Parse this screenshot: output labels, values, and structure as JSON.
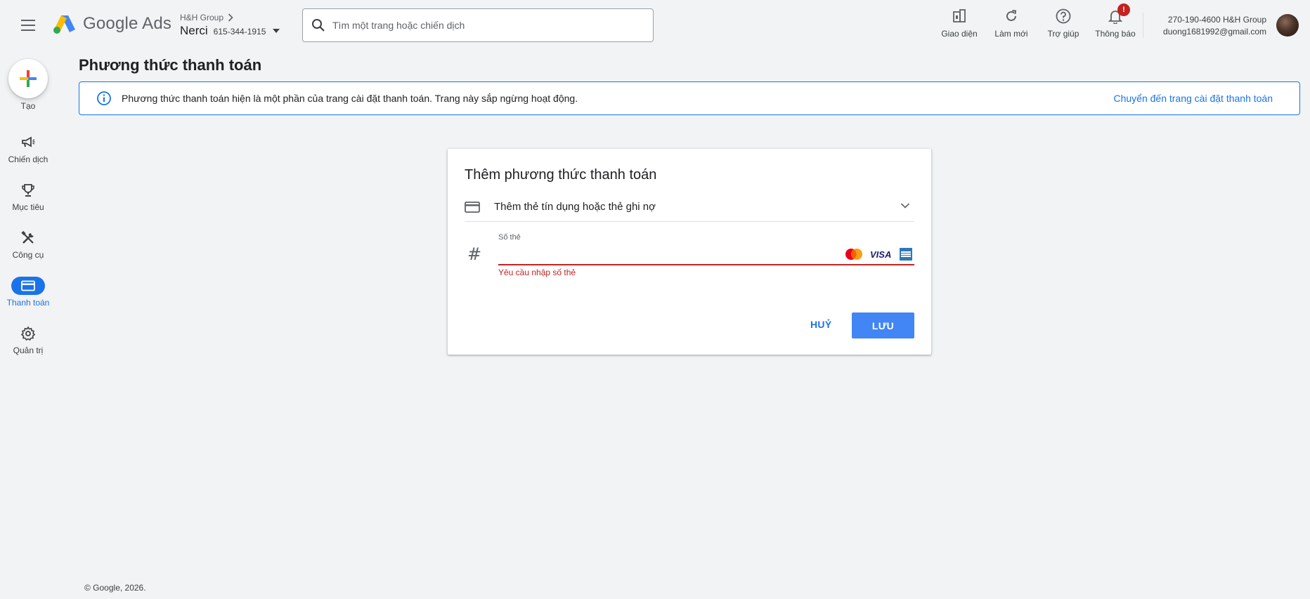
{
  "header": {
    "app_name": "Google Ads",
    "parent_account": "H&H Group",
    "account_name": "Nerci",
    "account_id": "615-344-1915",
    "search_placeholder": "Tìm một trang hoặc chiến dịch",
    "actions": [
      {
        "label": "Giao diện",
        "icon": "appearance-icon"
      },
      {
        "label": "Làm mới",
        "icon": "refresh-icon"
      },
      {
        "label": "Trợ giúp",
        "icon": "help-icon"
      },
      {
        "label": "Thông báo",
        "icon": "bell-icon",
        "badge": "!"
      }
    ],
    "user_line1": "270-190-4600 H&H Group",
    "user_line2": "duong1681992@gmail.com"
  },
  "sidebar": {
    "create_label": "Tạo",
    "items": [
      {
        "label": "Chiến dịch",
        "icon": "megaphone-icon"
      },
      {
        "label": "Mục tiêu",
        "icon": "trophy-icon"
      },
      {
        "label": "Công cụ",
        "icon": "tools-icon"
      },
      {
        "label": "Thanh toán",
        "icon": "credit-card-icon",
        "active": true
      },
      {
        "label": "Quản trị",
        "icon": "gear-icon"
      }
    ]
  },
  "page": {
    "title": "Phương thức thanh toán",
    "banner_message": "Phương thức thanh toán hiện là một phần của trang cài đặt thanh toán. Trang này sắp ngừng hoạt động.",
    "banner_link": "Chuyển đến trang cài đặt thanh toán"
  },
  "dialog": {
    "title": "Thêm phương thức thanh toán",
    "method_label": "Thêm thẻ tín dụng hoặc thẻ ghi nợ",
    "card_number_label": "Số thẻ",
    "card_number_value": "",
    "error": "Yêu cầu nhập số thẻ",
    "brands": [
      "Mastercard",
      "VISA",
      "American Express"
    ],
    "cancel_label": "HUỶ",
    "save_label": "LƯU"
  },
  "footer": {
    "copyright": "© Google, 2026."
  },
  "colors": {
    "accent": "#1a73e8",
    "primary_button": "#4285f4",
    "error": "#c5221f"
  }
}
